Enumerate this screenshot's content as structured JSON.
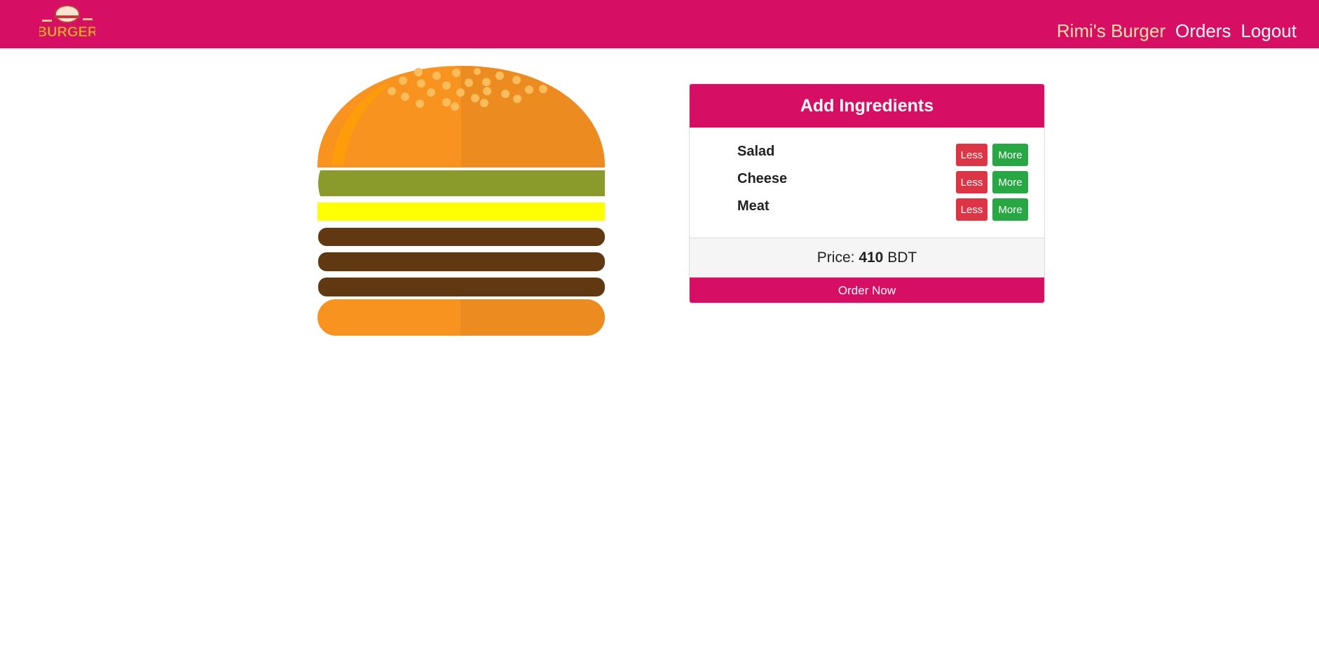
{
  "nav": {
    "logo_text": "BURGER",
    "links": [
      {
        "label": "Rimi's Burger",
        "active": true
      },
      {
        "label": "Orders"
      },
      {
        "label": "Logout"
      }
    ]
  },
  "builder": {
    "title": "Add Ingredients",
    "ingredients": [
      {
        "name": "Salad",
        "less": "Less",
        "more": "More"
      },
      {
        "name": "Cheese",
        "less": "Less",
        "more": "More"
      },
      {
        "name": "Meat",
        "less": "Less",
        "more": "More"
      }
    ],
    "price_label": "Price:",
    "price_value": "410",
    "price_currency": "BDT",
    "order_button": "Order Now"
  },
  "colors": {
    "brand": "#d70f64",
    "less": "#dc3545",
    "more": "#28a745",
    "bun": "#f7931e",
    "salad": "#8a9b2b",
    "cheese": "#ffff00",
    "meat": "#603913"
  }
}
